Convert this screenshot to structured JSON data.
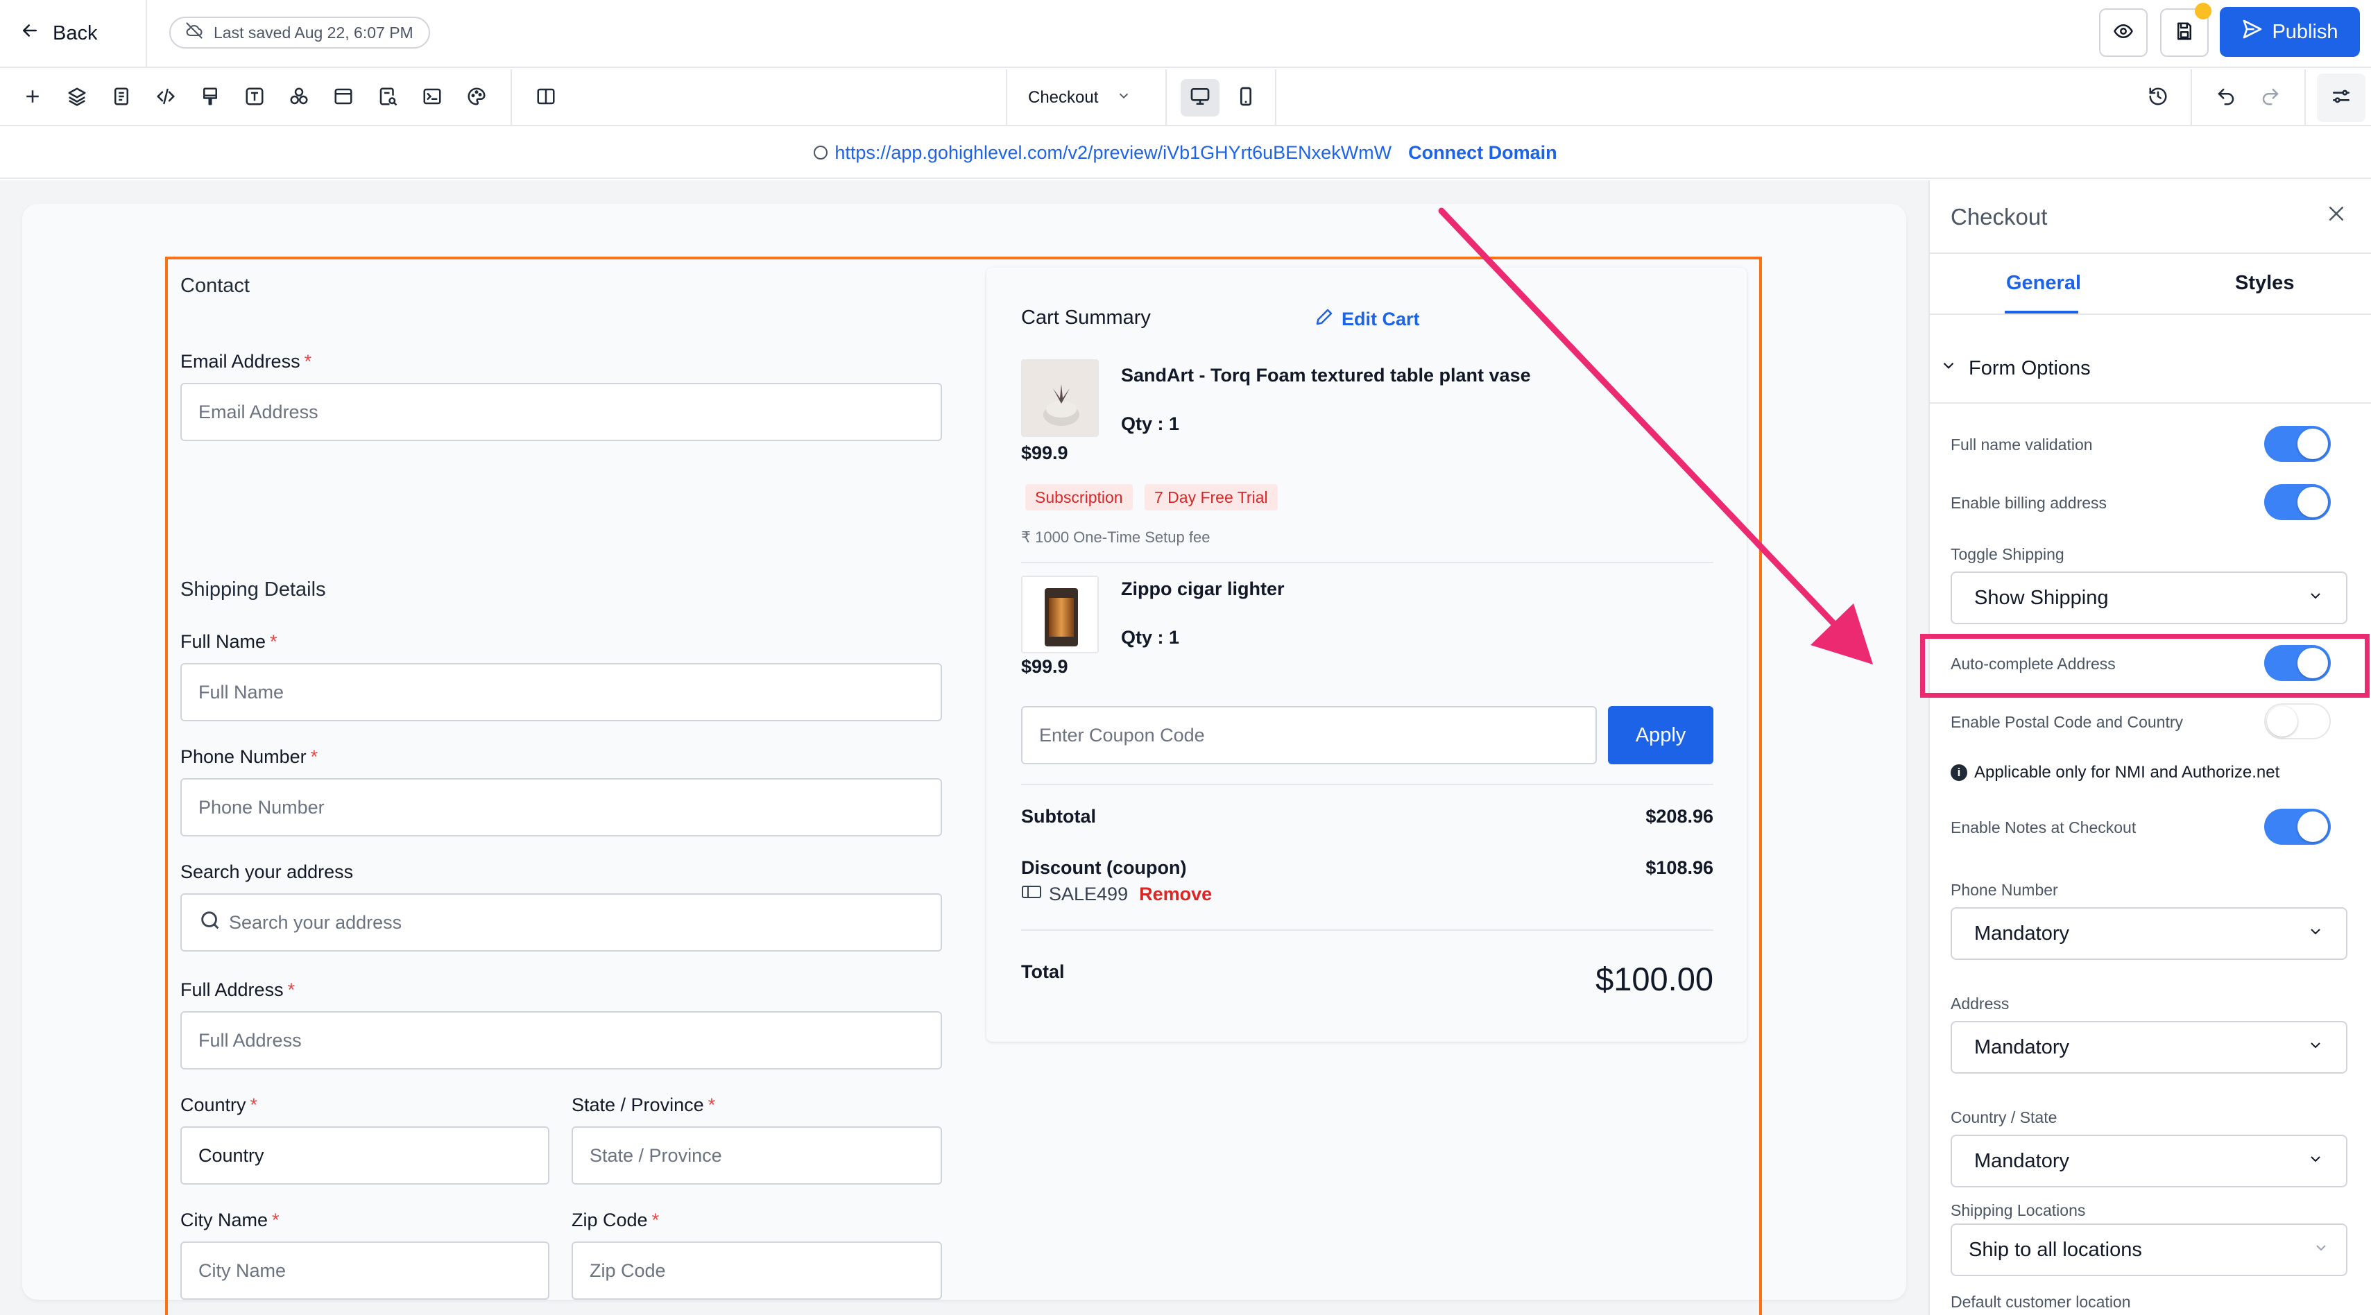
{
  "topbar": {
    "back_label": "Back",
    "saved_text": "Last saved Aug 22, 6:07 PM",
    "publish_label": "Publish"
  },
  "toolbar": {
    "page_selector": "Checkout"
  },
  "urlbar": {
    "url": "https://app.gohighlevel.com/v2/preview/iVb1GHYrt6uBENxekWmW",
    "connect_label": "Connect Domain"
  },
  "form": {
    "contact_title": "Contact",
    "email_label": "Email Address",
    "email_placeholder": "Email Address",
    "shipping_title": "Shipping Details",
    "fullname_label": "Full Name",
    "fullname_placeholder": "Full Name",
    "phone_label": "Phone Number",
    "phone_placeholder": "Phone Number",
    "search_label": "Search your address",
    "search_placeholder": "Search your address",
    "address_label": "Full Address",
    "address_placeholder": "Full Address",
    "country_label": "Country",
    "country_value": "Country",
    "state_label": "State / Province",
    "state_placeholder": "State / Province",
    "city_label": "City Name",
    "city_placeholder": "City Name",
    "zip_label": "Zip Code",
    "zip_placeholder": "Zip Code",
    "required_mark": "*"
  },
  "cart": {
    "title": "Cart Summary",
    "edit_label": "Edit Cart",
    "items": [
      {
        "name": "SandArt - Torq Foam textured table plant vase",
        "qty": "Qty : 1",
        "price": "$99.9"
      },
      {
        "name": "Zippo cigar lighter",
        "qty": "Qty : 1",
        "price": "$99.9"
      }
    ],
    "tags": [
      "Subscription",
      "7 Day Free Trial"
    ],
    "setup_fee": "₹ 1000 One-Time Setup fee",
    "coupon_placeholder": "Enter Coupon Code",
    "apply_label": "Apply",
    "subtotal_label": "Subtotal",
    "subtotal_value": "$208.96",
    "discount_label": "Discount (coupon)",
    "discount_value": "$108.96",
    "coupon_code": "SALE499",
    "remove_label": "Remove",
    "total_label": "Total",
    "total_value": "$100.00"
  },
  "panel": {
    "title": "Checkout",
    "tabs": [
      "General",
      "Styles"
    ],
    "section": "Form Options",
    "options": [
      {
        "label": "Full name validation",
        "on": true
      },
      {
        "label": "Enable billing address",
        "on": true
      },
      {
        "label": "Auto-complete Address",
        "on": true
      },
      {
        "label": "Enable Postal Code and Country",
        "on": false
      },
      {
        "label": "Enable Notes at Checkout",
        "on": true
      }
    ],
    "toggle_shipping_label": "Toggle Shipping",
    "toggle_shipping_value": "Show Shipping",
    "info_note": "Applicable only for NMI and Authorize.net",
    "info_icon": "i",
    "phone_label": "Phone Number",
    "phone_value": "Mandatory",
    "address_label": "Address",
    "address_value": "Mandatory",
    "country_state_label": "Country / State",
    "country_state_value": "Mandatory",
    "shipping_locations_label": "Shipping Locations",
    "shipping_locations_value": "Ship to all locations",
    "default_location_label": "Default customer location"
  },
  "colors": {
    "accent": "#1d63e8",
    "highlight": "#ec2a72",
    "section_outline": "#f97316",
    "toggle_on": "#3b82f6"
  }
}
